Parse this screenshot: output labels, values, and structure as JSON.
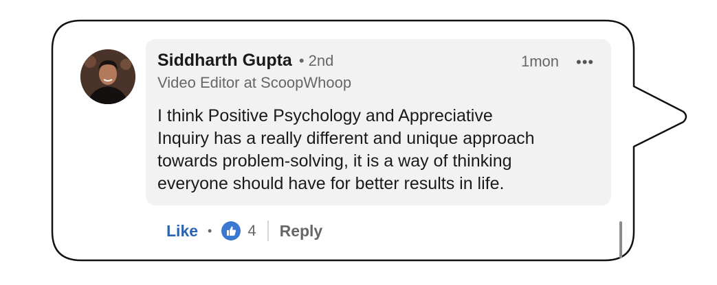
{
  "comment": {
    "author_name": "Siddharth Gupta",
    "connection_degree": "• 2nd",
    "headline": "Video Editor at ScoopWhoop",
    "timestamp": "1mon",
    "more_label": "•••",
    "body_lines": [
      "I think Positive Psychology and Appreciative",
      "Inquiry has a really different and unique approach",
      "towards problem-solving, it is a way of thinking",
      "everyone should have for better results in life."
    ]
  },
  "actions": {
    "like_label": "Like",
    "separator": "•",
    "reaction_icon": "thumbs-up-icon",
    "reaction_count": "4",
    "reply_label": "Reply"
  },
  "colors": {
    "like_blue": "#2a62b4",
    "reaction_blue": "#3b78d0",
    "comment_bg": "#f2f2f2",
    "secondary_text": "#666666"
  }
}
